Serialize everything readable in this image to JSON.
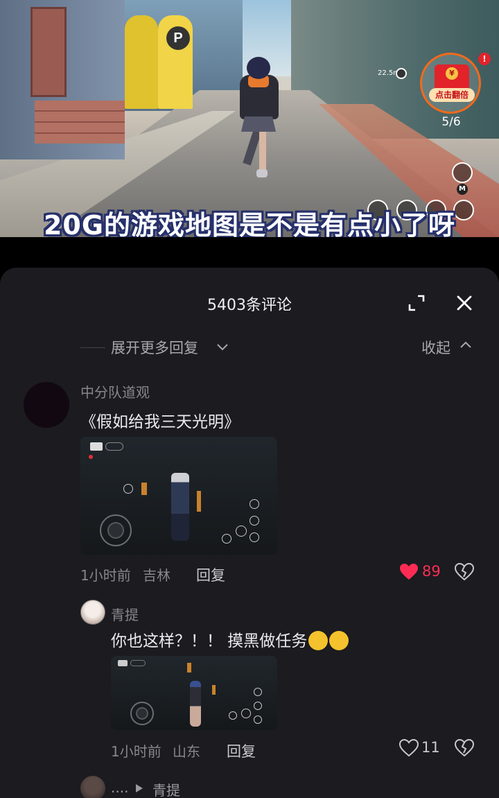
{
  "video": {
    "subtitle": "20G的游戏地图是不是有点小了呀",
    "distance": "22.5m",
    "redpacket_label": "点击翻倍",
    "redpacket_coin": "¥",
    "redpacket_badge": "!",
    "redpacket_progress": "5/6",
    "hud_m": "M",
    "parking_sign": "P"
  },
  "panel": {
    "title": "5403条评论",
    "expand_more": "展开更多回复",
    "collapse": "收起"
  },
  "comments": [
    {
      "user": "中分队道观",
      "text": "《假如给我三天光明》",
      "time": "1小时前",
      "location": "吉林",
      "reply": "回复",
      "likes": "89",
      "liked": true
    },
    {
      "user": "青提",
      "text": "你也这样？！！ 摸黑做任务",
      "time": "1小时前",
      "location": "山东",
      "reply": "回复",
      "likes": "11",
      "liked": false
    }
  ],
  "next_reply": {
    "prefix": "....",
    "user": "青提"
  },
  "colors": {
    "panel_bg": "#1b1b20",
    "liked": "#fe2c55",
    "muted": "#86868c"
  }
}
